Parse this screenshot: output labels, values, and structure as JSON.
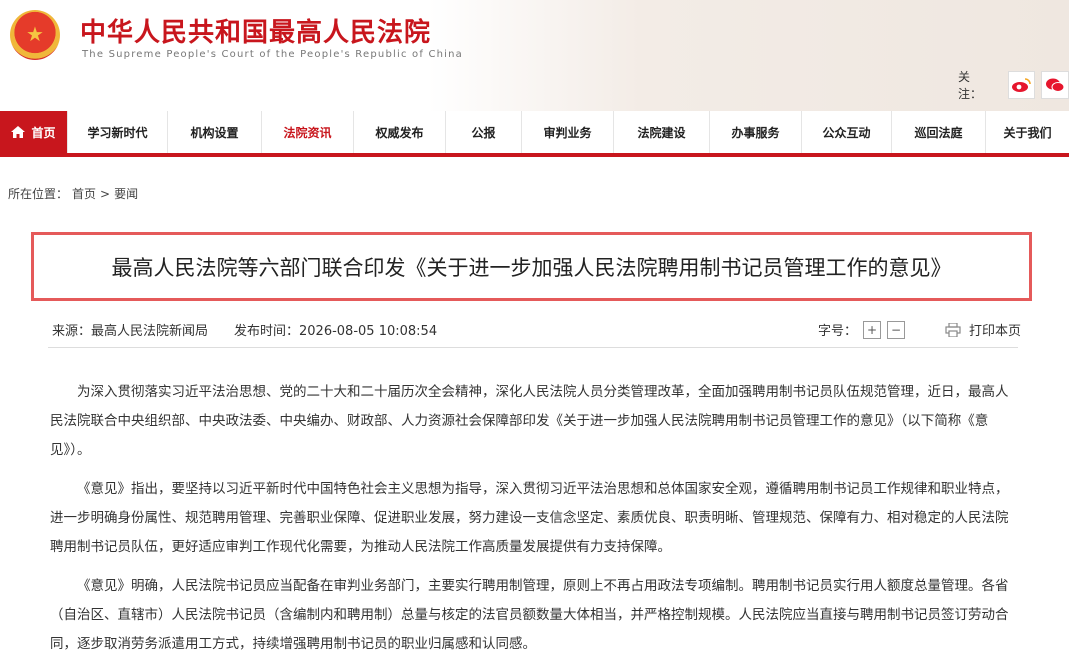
{
  "header": {
    "title": "中华人民共和国最高人民法院",
    "subtitle": "The Supreme People's Court of the People's Republic of China",
    "follow_label": "关注："
  },
  "nav": {
    "items": [
      "首页",
      "学习新时代",
      "机构设置",
      "法院资讯",
      "权威发布",
      "公报",
      "审判业务",
      "法院建设",
      "办事服务",
      "公众互动",
      "巡回法庭",
      "关于我们"
    ],
    "active_color": "#c8161d"
  },
  "breadcrumb": {
    "prefix": "所在位置：",
    "home": "首页",
    "sep": ">",
    "current": "要闻"
  },
  "article": {
    "title": "最高人民法院等六部门联合印发《关于进一步加强人民法院聘用制书记员管理工作的意见》",
    "source": "来源：最高人民法院新闻局",
    "published": "发布时间：2026-08-05 10:08:54",
    "font_label": "字号：",
    "font_plus": "+",
    "font_minus": "−",
    "print_label": "打印本页",
    "paragraphs": [
      "为深入贯彻落实习近平法治思想、党的二十大和二十届历次全会精神，深化人民法院人员分类管理改革，全面加强聘用制书记员队伍规范管理，近日，最高人民法院联合中央组织部、中央政法委、中央编办、财政部、人力资源社会保障部印发《关于进一步加强人民法院聘用制书记员管理工作的意见》（以下简称《意见》）。",
      "《意见》指出，要坚持以习近平新时代中国特色社会主义思想为指导，深入贯彻习近平法治思想和总体国家安全观，遵循聘用制书记员工作规律和职业特点，进一步明确身份属性、规范聘用管理、完善职业保障、促进职业发展，努力建设一支信念坚定、素质优良、职责明晰、管理规范、保障有力、相对稳定的人民法院聘用制书记员队伍，更好适应审判工作现代化需要，为推动人民法院工作高质量发展提供有力支持保障。",
      "《意见》明确，人民法院书记员应当配备在审判业务部门，主要实行聘用制管理，原则上不再占用政法专项编制。聘用制书记员实行用人额度总量管理。各省（自治区、直辖市）人民法院书记员（含编制内和聘用制）总量与核定的法官员额数量大体相当，并严格控制规模。人民法院应当直接与聘用制书记员签订劳动合同，逐步取消劳务派遣用工方式，持续增强聘用制书记员的职业归属感和认同感。"
    ]
  }
}
